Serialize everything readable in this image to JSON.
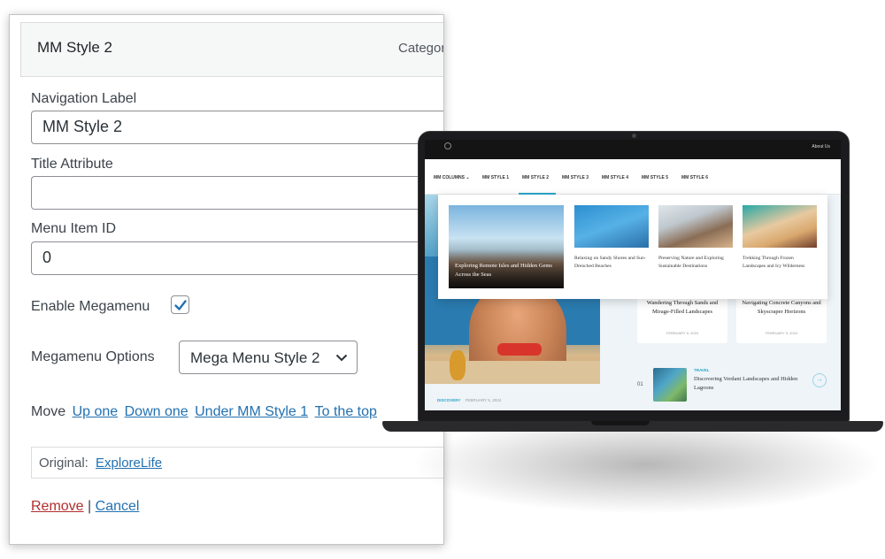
{
  "menu_item": {
    "title": "MM Style 2",
    "type_label": "Category",
    "navigation_label": {
      "label": "Navigation Label",
      "value": "MM Style 2"
    },
    "title_attribute": {
      "label": "Title Attribute",
      "value": ""
    },
    "menu_item_id": {
      "label": "Menu Item ID",
      "value": "0"
    },
    "enable_megamenu": {
      "label": "Enable Megamenu",
      "checked": true
    },
    "megamenu_options": {
      "label": "Megamenu Options",
      "selected": "Mega Menu Style 2"
    },
    "move": {
      "label": "Move",
      "links": [
        "Up one",
        "Down one",
        "Under MM Style 1",
        "To the top"
      ]
    },
    "original": {
      "label": "Original:",
      "link": "ExploreLife"
    },
    "actions": {
      "remove": "Remove",
      "separator": "|",
      "cancel": "Cancel"
    }
  },
  "preview": {
    "top_bar": {
      "about": "About Us"
    },
    "nav": {
      "items": [
        "MM COLUMNS",
        "MM STYLE 1",
        "MM STYLE 2",
        "MM STYLE 3",
        "MM STYLE 4",
        "MM STYLE 5",
        "MM STYLE 6"
      ],
      "active": "MM STYLE 2"
    },
    "mega_menu": {
      "feature": "Exploring Remote Isles and Hidden Gems Across the Seas",
      "cards": [
        "Relaxing on Sandy Shores and Sun-Drenched Beaches",
        "Preserving Nature and Exploring Sustainable Destinations",
        "Trekking Through Frozen Landscapes and Icy Wilderness"
      ]
    },
    "hero": {
      "category": "DISCOVERY",
      "date": "FEBRUARY 5, 2024"
    },
    "background_cards": [
      {
        "title": "Wandering Through Sands and Mirage-Filled Landscapes",
        "date": "FEBRUARY 5, 2024"
      },
      {
        "title": "Navigating Concrete Canyons and Skyscraper Horizons",
        "date": "FEBRUARY 5, 2024"
      }
    ],
    "list_item": {
      "number": "01",
      "category": "TRAVEL",
      "title": "Discovering Verdant Landscapes and Hidden Lagoons",
      "arrow": "→"
    },
    "colors": {
      "accent": "#2aa6c9",
      "link": "#2271b1",
      "remove": "#b32d2e"
    }
  }
}
